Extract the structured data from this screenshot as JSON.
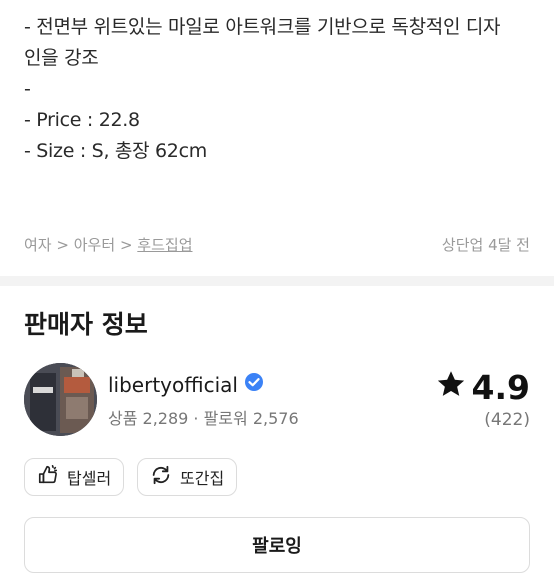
{
  "description": {
    "lines": [
      "- 전면부 위트있는 마일로 아트워크를 기반으로 독창적인 디자",
      "인을 강조",
      "",
      "-",
      "- Price : 22.8",
      "- Size : S, 총장 62cm"
    ]
  },
  "breadcrumb": {
    "level1": "여자",
    "level2": "아우터",
    "level3": "후드집업",
    "separator": ">"
  },
  "posted_time": "상단업 4달 전",
  "seller_section": {
    "title": "판매자 정보",
    "name": "libertyofficial",
    "verified": true,
    "stats": "상품 2,289 · 팔로워 2,576",
    "rating": "4.9",
    "rating_count": "(422)",
    "badges": [
      {
        "label": "탑셀러",
        "icon": "thumbs-up-icon"
      },
      {
        "label": "또간집",
        "icon": "repeat-icon"
      }
    ],
    "follow_label": "팔로잉"
  },
  "colors": {
    "verified_blue": "#3b82f6",
    "muted_text": "#9a9a9a",
    "divider": "#f3f3f3"
  }
}
